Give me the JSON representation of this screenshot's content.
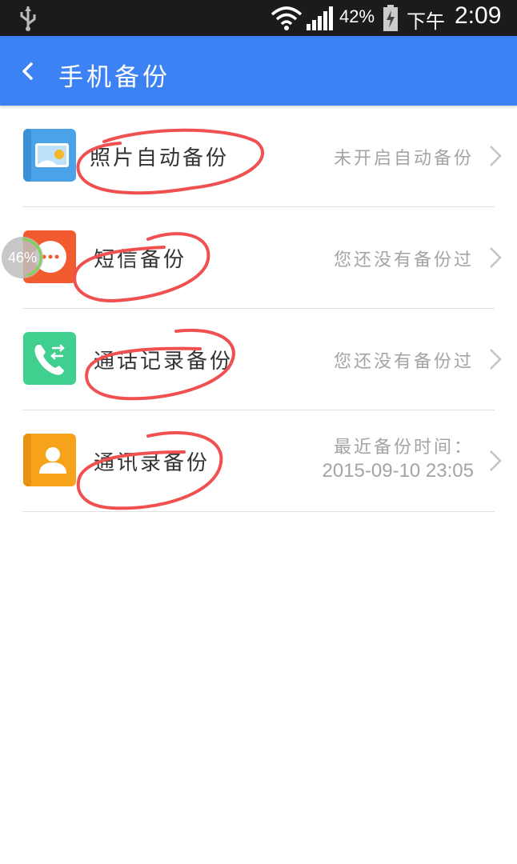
{
  "status_bar": {
    "battery_percent": "42%",
    "ampm": "下午",
    "time": "2:09",
    "icons": [
      "usb-icon",
      "wifi-icon",
      "signal-icon",
      "battery-charging-icon"
    ]
  },
  "header": {
    "back_icon": "back-arrow-icon",
    "title": "手机备份"
  },
  "items": [
    {
      "label": "照片自动备份",
      "status": "未开启自动备份",
      "icon": "photo-icon",
      "icon_color": "#4aa3e8"
    },
    {
      "label": "短信备份",
      "status": "您还没有备份过",
      "icon": "sms-icon",
      "icon_color": "#f25a2f"
    },
    {
      "label": "通话记录备份",
      "status": "您还没有备份过",
      "icon": "call-log-icon",
      "icon_color": "#3fcf8e"
    },
    {
      "label": "通讯录备份",
      "status_line1": "最近备份时间：",
      "status_line2": "2015-09-10 23:05",
      "icon": "contacts-icon",
      "icon_color": "#f7a21b"
    }
  ],
  "floating_ball": {
    "label": "46%",
    "progress": 0.46
  },
  "colors": {
    "header_bg": "#3d82f5",
    "status_bar_bg": "#1b1b1b",
    "annotation_red": "#f05050"
  }
}
